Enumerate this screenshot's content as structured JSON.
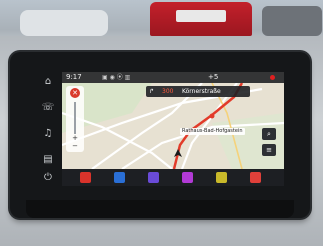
{
  "status_bar": {
    "time": "9:17",
    "temperature": "+5"
  },
  "navigation": {
    "distance": "300",
    "street": "Körnerstraße",
    "destination_label": "Rathaus-Bad-Hofgastein"
  },
  "colors": {
    "route": "#e23b2a",
    "record_dot": "#e02020",
    "dock_background": "#1d1f23"
  },
  "dock_apps": [
    {
      "icon": "app-red-icon",
      "color": "#d9332b"
    },
    {
      "icon": "flag-icon",
      "color": "#2a6fd6"
    },
    {
      "icon": "media-play-icon",
      "color": "#6a4bd8"
    },
    {
      "icon": "apps-grid-icon",
      "color": "#b23ad6"
    },
    {
      "icon": "phone-icon",
      "color": "#c9b92a"
    },
    {
      "icon": "settings-icon",
      "color": "#e0403a"
    }
  ]
}
